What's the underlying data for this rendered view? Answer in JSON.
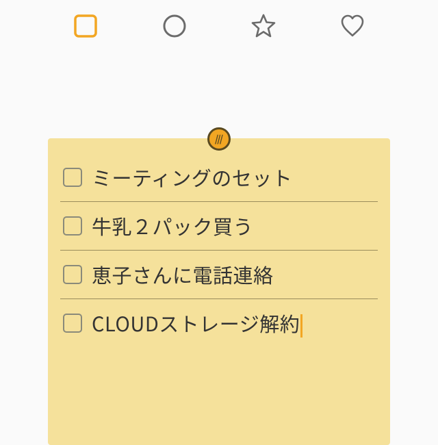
{
  "toolbar": {
    "shapes": [
      "square",
      "circle",
      "star",
      "heart"
    ],
    "selected": "square"
  },
  "note": {
    "items": [
      {
        "text": "ミーティングのセット",
        "checked": false
      },
      {
        "text": "牛乳２パック買う",
        "checked": false
      },
      {
        "text": "恵子さんに電話連絡",
        "checked": false
      },
      {
        "text": "CLOUDストレージ解約",
        "checked": false
      }
    ],
    "editing_index": 3
  },
  "colors": {
    "accent": "#f2a623",
    "note_bg": "#f5e19b",
    "icon_inactive": "#6b6b6b"
  }
}
